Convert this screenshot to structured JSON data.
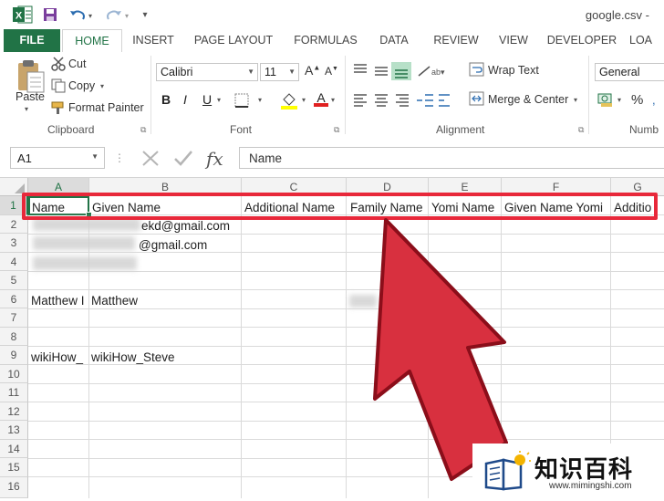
{
  "titlebar": {
    "filename": "google.csv - "
  },
  "tabs": [
    "FILE",
    "HOME",
    "INSERT",
    "PAGE LAYOUT",
    "FORMULAS",
    "DATA",
    "REVIEW",
    "VIEW",
    "DEVELOPER",
    "LOA"
  ],
  "clipboard": {
    "paste": "Paste",
    "cut": "Cut",
    "copy": "Copy",
    "format_painter": "Format Painter",
    "group": "Clipboard"
  },
  "font": {
    "name": "Calibri",
    "size": "11",
    "group": "Font",
    "grow": "A",
    "shrink": "A",
    "bold": "B",
    "italic": "I",
    "underline": "U",
    "font_color": "A"
  },
  "alignment": {
    "wrap_text": "Wrap Text",
    "merge_center": "Merge & Center",
    "group": "Alignment"
  },
  "number": {
    "format": "General",
    "percent": "%",
    "group": "Numb"
  },
  "formula_bar": {
    "name_box": "A1",
    "fx": "fx",
    "value": "Name"
  },
  "columns": [
    "A",
    "B",
    "C",
    "D",
    "E",
    "F",
    "G"
  ],
  "rows": [
    "1",
    "2",
    "3",
    "4",
    "5",
    "6",
    "7",
    "8",
    "9",
    "10",
    "11",
    "12",
    "13",
    "14",
    "15",
    "16"
  ],
  "cells": {
    "a1": "Name",
    "b1": "Given Name",
    "c1": "Additional Name",
    "d1": "Family Name",
    "e1": "Yomi Name",
    "f1": "Given Name Yomi",
    "g1": "Additio",
    "b2": "ekd@gmail.com",
    "b3": "@gmail.com",
    "a6": "Matthew I",
    "b6": "Matthew",
    "a9": "wikiHow_",
    "b9": "wikiHow_Steve"
  },
  "watermark": {
    "brand": "知识百科",
    "url": "www.mimingshi.com"
  },
  "colors": {
    "excel_green": "#217346",
    "highlight_red": "#e8283a",
    "arrow_red": "#d8303f"
  }
}
